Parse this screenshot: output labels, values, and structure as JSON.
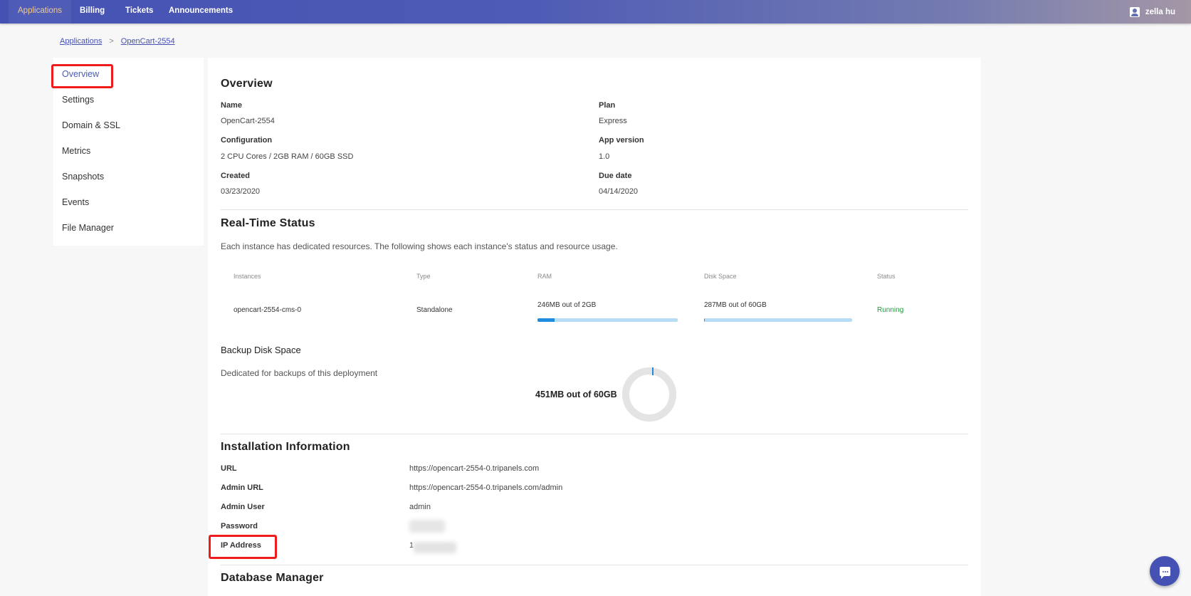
{
  "topnav": {
    "items": [
      {
        "label": "Applications"
      },
      {
        "label": "Billing"
      },
      {
        "label": "Tickets"
      },
      {
        "label": "Announcements"
      }
    ],
    "user": "zella hu"
  },
  "breadcrumb": {
    "root": "Applications",
    "sep": ">",
    "current": "OpenCart-2554"
  },
  "sidebar": {
    "items": [
      {
        "label": "Overview"
      },
      {
        "label": "Settings"
      },
      {
        "label": "Domain & SSL"
      },
      {
        "label": "Metrics"
      },
      {
        "label": "Snapshots"
      },
      {
        "label": "Events"
      },
      {
        "label": "File Manager"
      }
    ]
  },
  "overview": {
    "title": "Overview",
    "name_label": "Name",
    "name_value": "OpenCart-2554",
    "plan_label": "Plan",
    "plan_value": "Express",
    "config_label": "Configuration",
    "config_value": "2 CPU Cores / 2GB RAM / 60GB SSD",
    "version_label": "App version",
    "version_value": "1.0",
    "created_label": "Created",
    "created_value": "03/23/2020",
    "due_label": "Due date",
    "due_value": "04/14/2020"
  },
  "realtime": {
    "title": "Real-Time Status",
    "description": "Each instance has dedicated resources. The following shows each instance's status and resource usage.",
    "headers": {
      "instances": "Instances",
      "type": "Type",
      "ram": "RAM",
      "disk": "Disk Space",
      "status": "Status"
    },
    "row": {
      "instance": "opencart-2554-cms-0",
      "type": "Standalone",
      "ram": "246MB out of 2GB",
      "ram_used_fraction": 0.12,
      "disk": "287MB out of 60GB",
      "disk_used_fraction": 0.005,
      "status": "Running"
    }
  },
  "backup": {
    "title": "Backup Disk Space",
    "description": "Dedicated for backups of this deployment",
    "usage": "451MB out of 60GB",
    "used_fraction": 0.007
  },
  "install": {
    "title": "Installation Information",
    "url_label": "URL",
    "url_value": "https://opencart-2554-0.tripanels.com",
    "admin_url_label": "Admin URL",
    "admin_url_value": "https://opencart-2554-0.tripanels.com/admin",
    "admin_user_label": "Admin User",
    "admin_user_value": "admin",
    "password_label": "Password",
    "ip_label": "IP Address",
    "ip_value_visible": "1"
  },
  "database": {
    "title": "Database Manager"
  },
  "colors": {
    "nav_start": "#4552b3",
    "accent": "#4a5ab8",
    "running": "#1a9e3a",
    "highlight": "#ee1c1c",
    "bar": "#1f8ce0"
  },
  "icons": {
    "user": "account-box-icon",
    "chat": "chat-bubble-icon"
  }
}
